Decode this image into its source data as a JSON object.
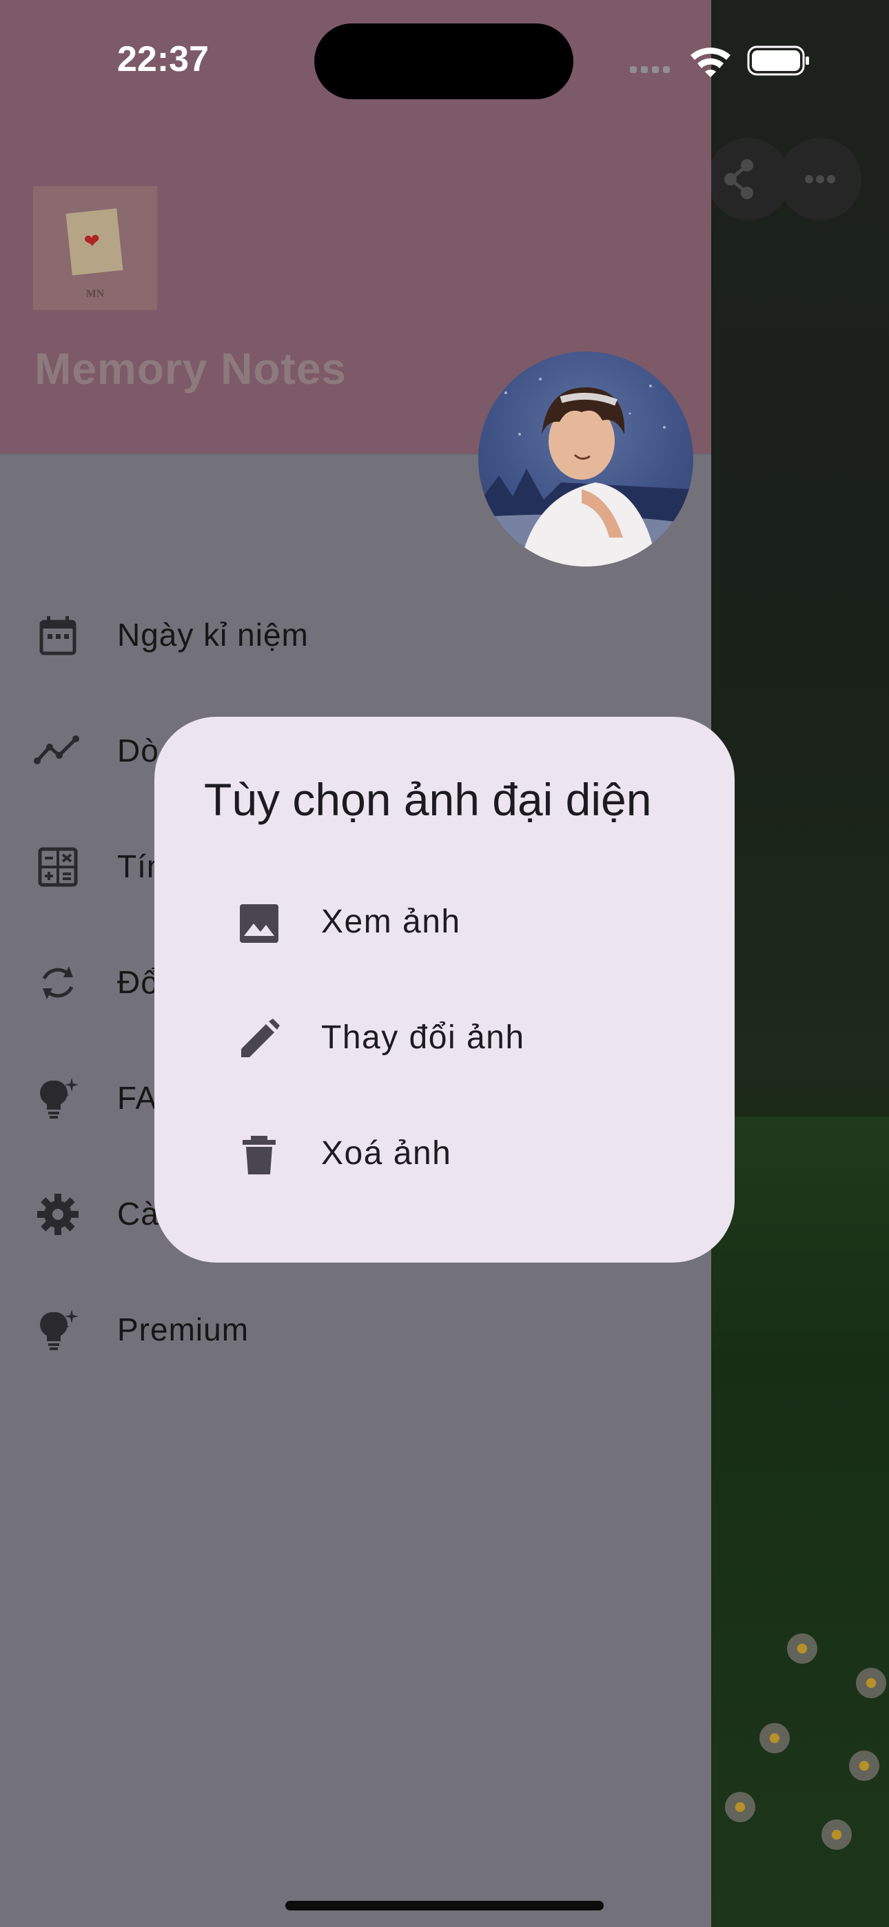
{
  "status_bar": {
    "time": "22:37"
  },
  "drawer": {
    "logo_text": "MN",
    "app_title": "Memory Notes",
    "menu": [
      {
        "label": "Ngày kỉ niệm",
        "icon": "calendar-icon"
      },
      {
        "label": "Dò",
        "icon": "trending-line-icon"
      },
      {
        "label": "Tín",
        "icon": "calculator-icon"
      },
      {
        "label": "Đổ",
        "icon": "sync-icon"
      },
      {
        "label": "FA",
        "icon": "lightbulb-sparkle-icon"
      },
      {
        "label": "Cà",
        "icon": "gear-icon"
      },
      {
        "label": "Premium",
        "icon": "lightbulb-sparkle-icon"
      }
    ]
  },
  "dialog": {
    "title": "Tùy chọn ảnh đại diện",
    "options": [
      {
        "label": "Xem ảnh",
        "icon": "image-icon"
      },
      {
        "label": "Thay đổi ảnh",
        "icon": "pencil-icon"
      },
      {
        "label": "Xoá ảnh",
        "icon": "trash-icon"
      }
    ]
  },
  "colors": {
    "drawer_header": "#7d5a67",
    "drawer_body": "#73717a",
    "dialog_bg": "#ece5f0",
    "text_dark": "#1d1b20"
  }
}
